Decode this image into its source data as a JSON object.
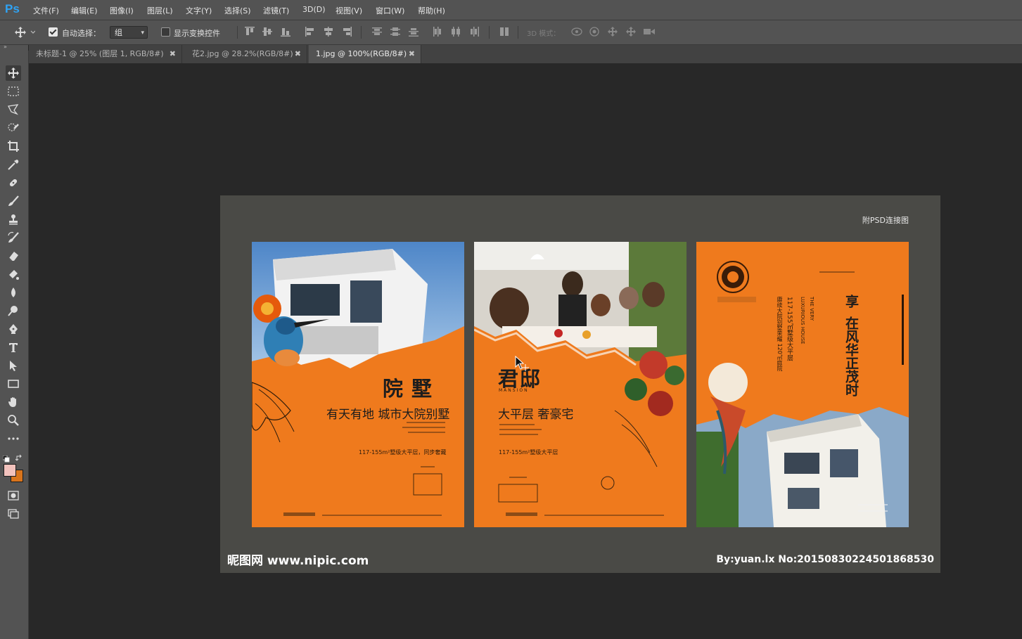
{
  "app": {
    "logo": "Ps"
  },
  "menu": [
    "文件(F)",
    "编辑(E)",
    "图像(I)",
    "图层(L)",
    "文字(Y)",
    "选择(S)",
    "滤镜(T)",
    "3D(D)",
    "视图(V)",
    "窗口(W)",
    "帮助(H)"
  ],
  "options": {
    "auto_select_label": "自动选择：",
    "auto_select_checked": true,
    "auto_select_value": "组",
    "show_transform_label": "显示变换控件",
    "show_transform_checked": false,
    "mode_3d_label": "3D 模式："
  },
  "tabs": [
    {
      "label": "未标题-1 @ 25% (图层 1, RGB/8#)",
      "close": "✖",
      "active": false
    },
    {
      "label": "花2.jpg @ 28.2%(RGB/8#)",
      "close": "✖",
      "active": false
    },
    {
      "label": "1.jpg @ 100%(RGB/8#)",
      "close": "✖",
      "active": true
    }
  ],
  "colors": {
    "foreground": "#f2c2bd",
    "background": "#d8741c",
    "poster_orange": "#ef7a1d"
  },
  "document": {
    "attach_label": "附PSD连接图",
    "watermark_left": "昵图网 www.nipic.com",
    "watermark_right": "By:yuan.lx No:20150830224501868530"
  },
  "posters": [
    {
      "headline": "院墅",
      "subhead": "有天有地 城市大院别墅",
      "spec": "117-155m²墅级大平层，同步奢藏"
    },
    {
      "headline": "君邸",
      "headline_en": "MANSION",
      "subhead": "大平层 奢豪宅",
      "spec": "117-155m²墅级大平层"
    },
    {
      "headline_char": "享",
      "headline_vertical": "在风华正茂时",
      "vertical_line1": "117-155㎡墅级大平层",
      "vertical_line2": "LUXURIOUS HOUSE",
      "vertical_line3": "THE VERY",
      "vertical_line4": "赓续大院别墅荣耀 120㎡庭院"
    }
  ]
}
